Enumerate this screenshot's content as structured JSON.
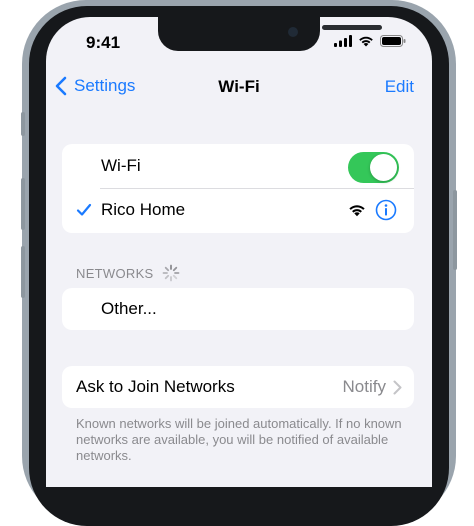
{
  "status_bar": {
    "time": "9:41"
  },
  "nav": {
    "back_label": "Settings",
    "title": "Wi-Fi",
    "edit_label": "Edit"
  },
  "wifi_group": {
    "toggle_label": "Wi-Fi",
    "toggle_on": true,
    "connected_network": "Rico Home"
  },
  "networks_section": {
    "header": "NETWORKS",
    "other_label": "Other..."
  },
  "ask_to_join": {
    "label": "Ask to Join Networks",
    "value": "Notify",
    "footer": "Known networks will be joined automatically. If no known networks are available, you will be notified of available networks."
  },
  "colors": {
    "accent": "#1a7aff",
    "toggle_on": "#34c759",
    "background": "#f2f2f7",
    "secondary_text": "#8a8a8e"
  },
  "icons": [
    "chevron-left-icon",
    "checkmark-icon",
    "wifi-icon",
    "info-icon",
    "spinner-icon",
    "chevron-right-icon",
    "cellular-signal-icon",
    "battery-icon"
  ]
}
